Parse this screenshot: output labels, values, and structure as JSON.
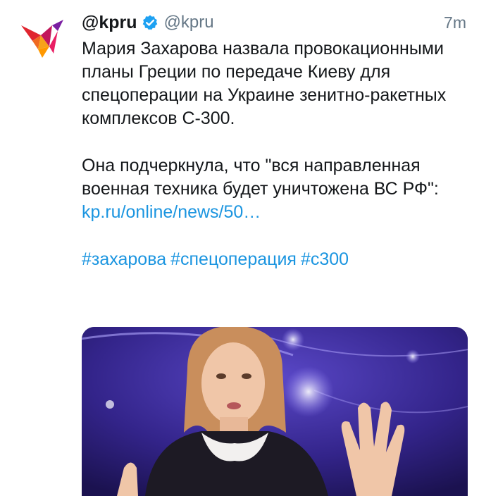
{
  "tweet": {
    "display_name": "@kpru",
    "handle": "@kpru",
    "time": "7m",
    "paragraph1": "Мария Захарова назвала провокационными планы Греции по передаче Киеву для спецоперации на Украине зенитно-ракетных комплексов С-300.",
    "paragraph2": "Она подчеркнула, что \"вся направленная военная техника будет уничтожена ВС РФ\":",
    "link": "kp.ru/online/news/50…",
    "hashtags": [
      "#захарова",
      "#спецоперация",
      "#с300"
    ],
    "icons": {
      "avatar": "kp-bird-logo",
      "verified": "verified-badge-icon"
    },
    "colors": {
      "link": "#1b95e0",
      "verified": "#1da1f2",
      "secondary_text": "#657786",
      "media_background": "#2a1f6d"
    }
  }
}
